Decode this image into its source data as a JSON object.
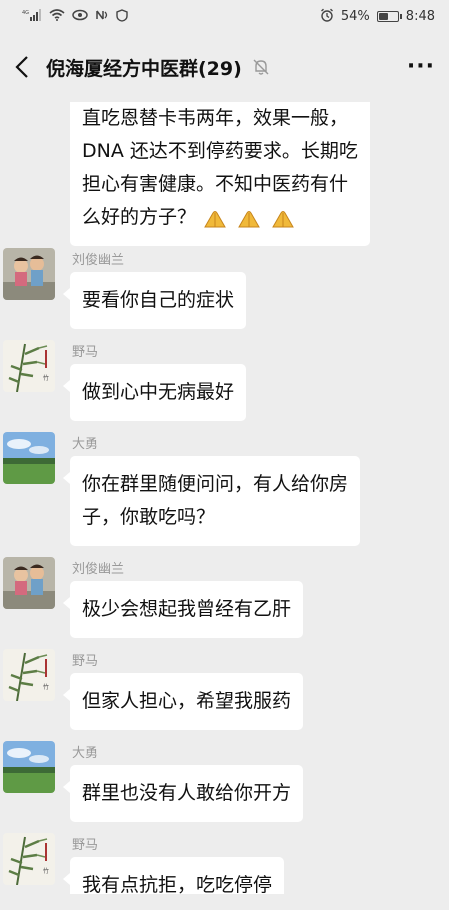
{
  "status_bar": {
    "signal_text": "4G",
    "battery_percent": "54%",
    "battery_level": 0.54,
    "time": "8:48"
  },
  "header": {
    "title": "倪海厦经方中医群(29)"
  },
  "messages": [
    {
      "sender": "",
      "avatar": "none",
      "lines": [
        "直吃恩替卡韦两年，效果一般，",
        "DNA 还达不到停药要求。长期吃",
        "担心有害健康。不知中医药有什",
        "么好的方子？"
      ],
      "emoji": [
        "folded-hands-icon",
        "folded-hands-icon",
        "folded-hands-icon"
      ]
    },
    {
      "sender": "刘俊幽兰",
      "avatar": "kids-photo",
      "lines": [
        "要看你自己的症状"
      ]
    },
    {
      "sender": "野马",
      "avatar": "bamboo-painting",
      "lines": [
        "做到心中无病最好"
      ]
    },
    {
      "sender": "大勇",
      "avatar": "landscape-photo",
      "lines": [
        "你在群里随便问问，有人给你房",
        "子，你敢吃吗？"
      ]
    },
    {
      "sender": "刘俊幽兰",
      "avatar": "kids-photo",
      "lines": [
        "极少会想起我曾经有乙肝"
      ]
    },
    {
      "sender": "野马",
      "avatar": "bamboo-painting",
      "lines": [
        "但家人担心，希望我服药"
      ]
    },
    {
      "sender": "大勇",
      "avatar": "landscape-photo",
      "lines": [
        "群里也没有人敢给你开方"
      ]
    },
    {
      "sender": "野马",
      "avatar": "bamboo-painting",
      "lines": [
        "我有点抗拒，吃吃停停"
      ]
    }
  ]
}
